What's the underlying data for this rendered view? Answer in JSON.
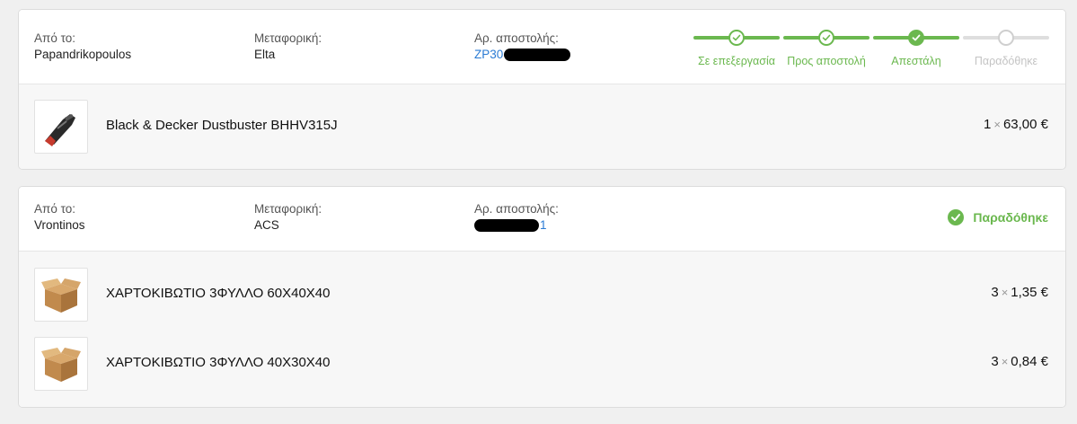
{
  "shipments": [
    {
      "from_label": "Από το:",
      "from_value": "Papandrikopoulos",
      "carrier_label": "Μεταφορική:",
      "carrier_value": "Elta",
      "tracking_label": "Αρ. αποστολής:",
      "tracking_visible": "ZP30",
      "steps": [
        {
          "label": "Σε επεξεργασία",
          "state": "done"
        },
        {
          "label": "Προς αποστολή",
          "state": "done"
        },
        {
          "label": "Απεστάλη",
          "state": "current"
        },
        {
          "label": "Παραδόθηκε",
          "state": "pending"
        }
      ],
      "items": [
        {
          "name": "Black & Decker Dustbuster BHHV315J",
          "qty": "1",
          "times": "×",
          "price": "63,00 €",
          "icon": "vacuum-image"
        }
      ]
    },
    {
      "from_label": "Από το:",
      "from_value": "Vrontinos",
      "carrier_label": "Μεταφορική:",
      "carrier_value": "ACS",
      "tracking_label": "Αρ. αποστολής:",
      "tracking_visible": "1",
      "status": "Παραδόθηκε",
      "items": [
        {
          "name": "ΧΑΡΤΟΚΙΒΩΤΙΟ 3ΦΥΛΛΟ 60Χ40Χ40",
          "qty": "3",
          "times": "×",
          "price": "1,35 €",
          "icon": "cardboard-box-image"
        },
        {
          "name": "ΧΑΡΤΟΚΙΒΩΤΙΟ 3ΦΥΛΛΟ 40Χ30Χ40",
          "qty": "3",
          "times": "×",
          "price": "0,84 €",
          "icon": "cardboard-box-image"
        }
      ]
    }
  ],
  "colors": {
    "accent_green": "#6bb84f",
    "link_blue": "#2a7bd4",
    "pending_gray": "#c4c4c4"
  }
}
